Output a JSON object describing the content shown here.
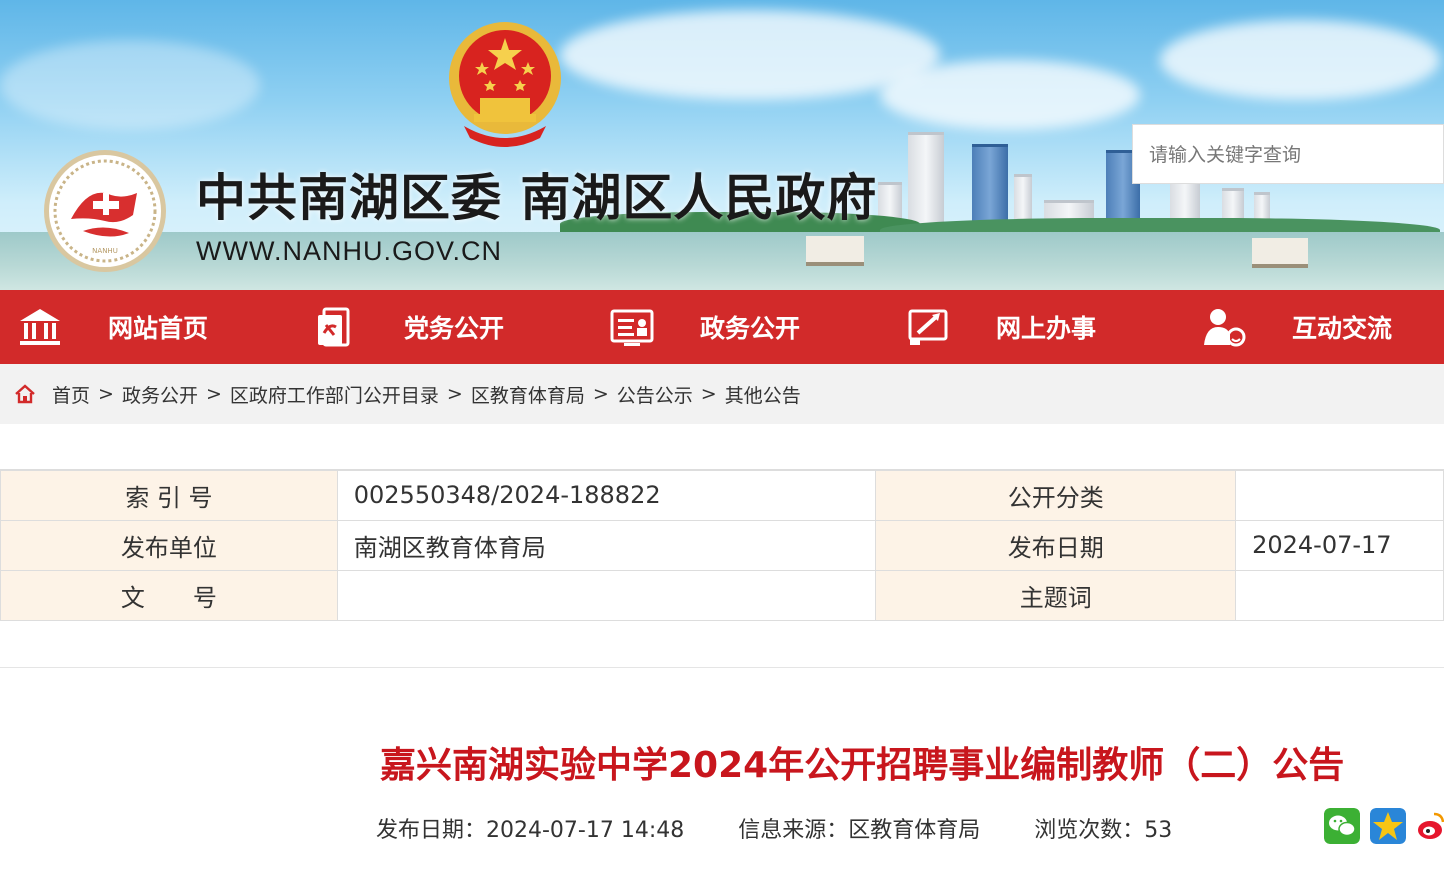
{
  "header": {
    "site_title": "中共南湖区委 南湖区人民政府",
    "site_url": "WWW.NANHU.GOV.CN",
    "search_placeholder": "请输入关键字查询"
  },
  "nav": {
    "items": [
      {
        "label": "网站首页",
        "icon": "building-icon"
      },
      {
        "label": "党务公开",
        "icon": "party-document-icon"
      },
      {
        "label": "政务公开",
        "icon": "id-card-icon"
      },
      {
        "label": "网上办事",
        "icon": "online-service-icon"
      },
      {
        "label": "互动交流",
        "icon": "user-chat-icon"
      }
    ]
  },
  "breadcrumb": {
    "items": [
      "首页",
      "政务公开",
      "区政府工作部门公开目录",
      "区教育体育局",
      "公告公示",
      "其他公告"
    ],
    "separator": ">"
  },
  "info_table": {
    "index_label": "索 引 号",
    "index_value": "002550348/2024-188822",
    "category_label": "公开分类",
    "category_value": "",
    "publisher_label": "发布单位",
    "publisher_value": "南湖区教育体育局",
    "date_label": "发布日期",
    "date_value": "2024-07-17",
    "docno_label": "文　　号",
    "docno_value": "",
    "keywords_label": "主题词",
    "keywords_value": ""
  },
  "article": {
    "title": "嘉兴南湖实验中学2024年公开招聘事业编制教师（二）公告",
    "publish_date": "发布日期：2024-07-17 14:48",
    "source": "信息来源：区教育体育局",
    "views": "浏览次数：53"
  },
  "share": [
    "wechat-icon",
    "qzone-icon",
    "weibo-icon"
  ],
  "colors": {
    "nav_bg": "#d22a2a",
    "title_red": "#c8161d",
    "table_key_bg": "#fdf3e7"
  }
}
